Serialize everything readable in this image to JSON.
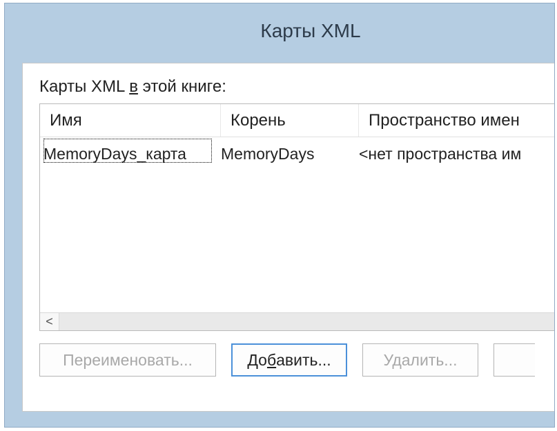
{
  "title": "Карты XML",
  "label_prefix": "Карты XML ",
  "label_ul": "в",
  "label_suffix": " этой книге:",
  "headers": {
    "name": "Имя",
    "root": "Корень",
    "ns": "Пространство имен"
  },
  "row": {
    "name": "MemoryDays_карта",
    "root": "MemoryDays",
    "ns": "<нет пространства им"
  },
  "buttons": {
    "rename": "Переименовать...",
    "add_pre": "До",
    "add_ul": "б",
    "add_post": "авить...",
    "delete": "Удалить..."
  },
  "scroll_left_glyph": "<"
}
